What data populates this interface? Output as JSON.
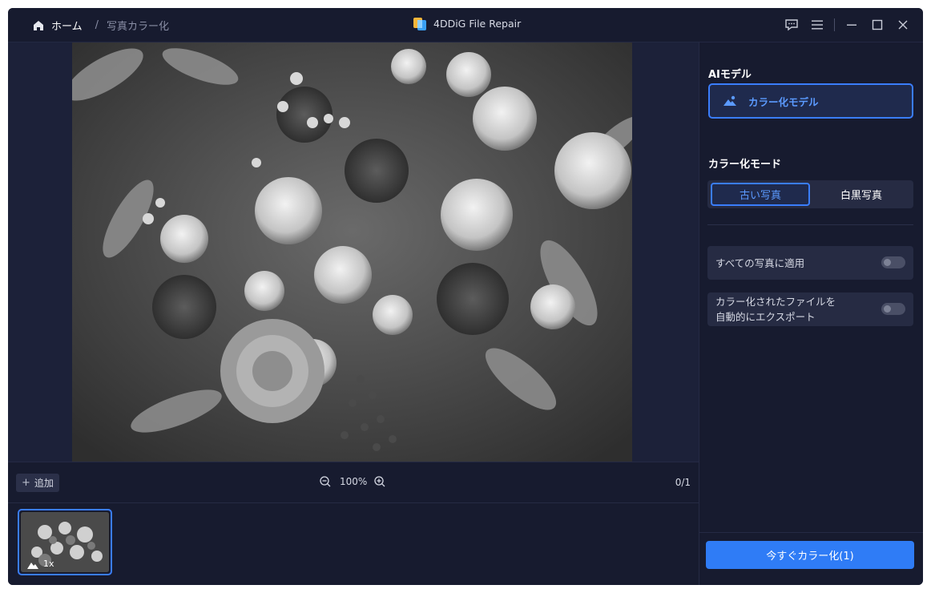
{
  "header": {
    "home_label": "ホーム",
    "separator": "/",
    "current_page": "写真カラー化",
    "app_title": "4DDiG File Repair"
  },
  "icons": {
    "home": "home-icon",
    "logo": "app-logo-icon",
    "feedback": "feedback-icon",
    "menu": "menu-icon",
    "minimize": "minimize-icon",
    "maximize": "maximize-icon",
    "close": "close-icon",
    "zoom_out": "zoom-out-icon",
    "zoom_in": "zoom-in-icon",
    "model": "image-model-icon"
  },
  "toolbar": {
    "add_label": "追加",
    "zoom_value": "100%",
    "counter": "0/1"
  },
  "thumbnail": {
    "badge": "1x"
  },
  "panel": {
    "ai_model_title": "AIモデル",
    "model_name": "カラー化モデル",
    "mode_title": "カラー化モード",
    "mode_options": [
      "古い写真",
      "白黒写真"
    ],
    "apply_all_label": "すべての写真に適用",
    "auto_export_line1": "カラー化されたファイルを",
    "auto_export_line2": "自動的にエクスポート",
    "cta_label": "今すぐカラー化(1)"
  },
  "colors": {
    "accent": "#3a7dfb",
    "background": "#171b2f",
    "button": "#2f7cf6"
  }
}
